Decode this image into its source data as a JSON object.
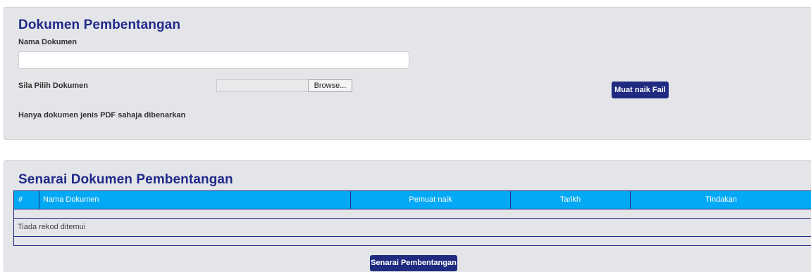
{
  "upload": {
    "title": "Dokumen Pembentangan",
    "name_label": "Nama Dokumen",
    "name_value": "",
    "choose_label": "Sila Pilih Dokumen",
    "browse_label": "Browse...",
    "note": "Hanya dokumen jenis PDF sahaja dibenarkan",
    "upload_button": "Muat naik Fail"
  },
  "list": {
    "title": "Senarai Dokumen Pembentangan",
    "columns": {
      "num": "#",
      "name": "Nama Dokumen",
      "uploader": "Pemuat naik",
      "date": "Tarikh",
      "action": "Tindakan"
    },
    "empty_message": "Tiada rekod ditemui",
    "list_button": "Senarai Pembentangan"
  },
  "colors": {
    "navy": "#1f2a80",
    "header_blue": "#03a9f4",
    "panel_bg": "#e4e5e8"
  }
}
